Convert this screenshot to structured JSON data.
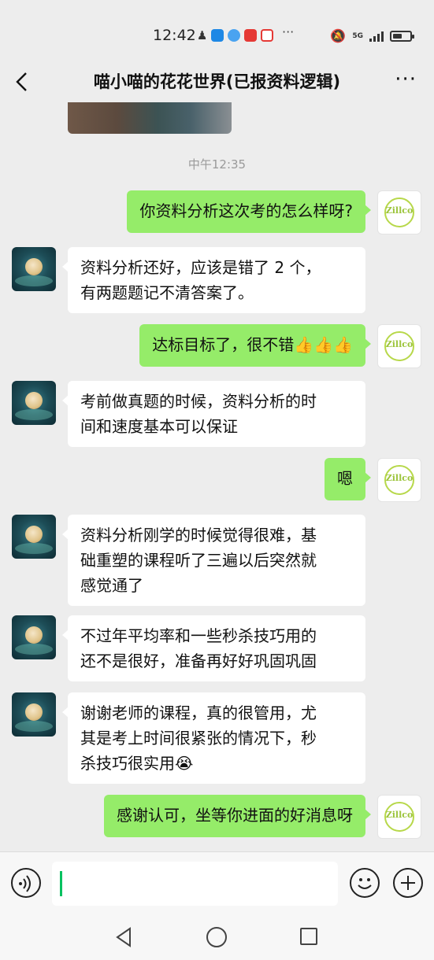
{
  "status_bar": {
    "time": "12:42",
    "signal_label": "5G",
    "battery_level": 0.55,
    "icons": [
      "paw-icon",
      "blue-app-icon",
      "blue-flower-icon",
      "red-app-icon",
      "red-app-icon-2"
    ],
    "more": "···"
  },
  "header": {
    "title": "喵小喵的花花世界(已报资料逻辑)",
    "more_label": "···"
  },
  "chat": {
    "timestamp": "中午12:35",
    "messages": [
      {
        "side": "right",
        "lines": [
          "你资料分析这次考的怎么样呀?"
        ]
      },
      {
        "side": "left",
        "lines": [
          "资料分析还好，应该是错了 2 个，",
          "有两题题记不清答案了。"
        ]
      },
      {
        "side": "right",
        "lines": [
          "达标目标了，很不错👍👍👍"
        ]
      },
      {
        "side": "left",
        "lines": [
          "考前做真题的时候，资料分析的时",
          "间和速度基本可以保证"
        ]
      },
      {
        "side": "right",
        "lines": [
          "嗯"
        ]
      },
      {
        "side": "left",
        "lines": [
          "资料分析刚学的时候觉得很难，基",
          "础重塑的课程听了三遍以后突然就",
          "感觉通了"
        ]
      },
      {
        "side": "left",
        "lines": [
          "不过年平均率和一些秒杀技巧用的",
          "还不是很好，准备再好好巩固巩固"
        ]
      },
      {
        "side": "left",
        "lines": [
          "谢谢老师的课程，真的很管用，尤",
          "其是考上时间很紧张的情况下，秒",
          "杀技巧很实用😭"
        ]
      },
      {
        "side": "right",
        "lines": [
          "感谢认可，坐等你进面的好消息呀"
        ]
      }
    ],
    "teacher_avatar_text": "Zillco"
  },
  "input_bar": {
    "placeholder": ""
  },
  "colors": {
    "background": "#ededed",
    "bubble_self": "#95ec69",
    "bubble_other": "#ffffff",
    "caret": "#07c160"
  }
}
